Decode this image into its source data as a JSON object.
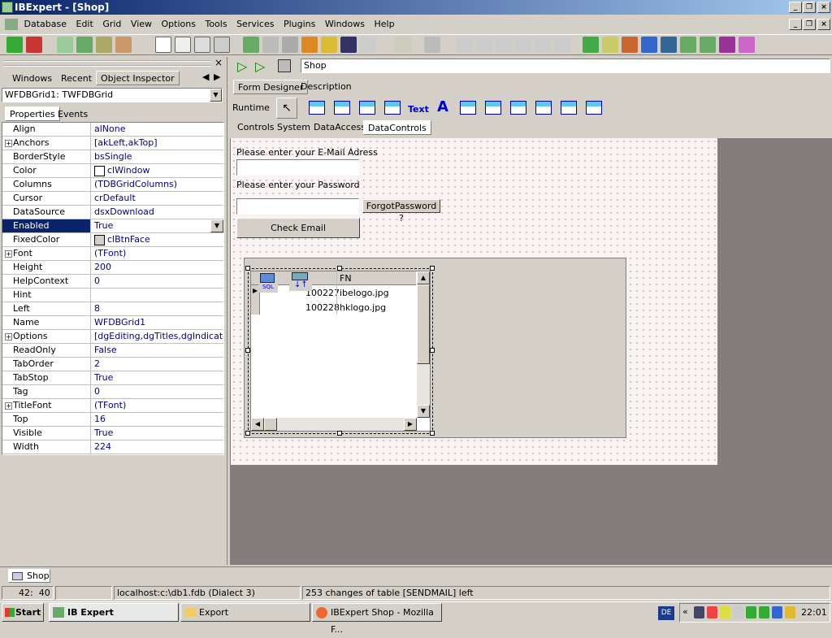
{
  "app": {
    "title": "IBExpert - [Shop]"
  },
  "menu": [
    "Database",
    "Edit",
    "Grid",
    "View",
    "Options",
    "Tools",
    "Services",
    "Plugins",
    "Windows",
    "Help"
  ],
  "left_panel": {
    "tabs": [
      "Windows",
      "Recent",
      "Object Inspector"
    ],
    "object_selector": "WFDBGrid1: TWFDBGrid",
    "subtabs": [
      "Properties",
      "Events"
    ],
    "properties": [
      {
        "k": "Align",
        "v": "alNone"
      },
      {
        "k": "Anchors",
        "v": "[akLeft,akTop]",
        "plus": true
      },
      {
        "k": "BorderStyle",
        "v": "bsSingle"
      },
      {
        "k": "Color",
        "v": "clWindow",
        "swatch": "#ffffff"
      },
      {
        "k": "Columns",
        "v": "(TDBGridColumns)"
      },
      {
        "k": "Cursor",
        "v": "crDefault"
      },
      {
        "k": "DataSource",
        "v": "dsxDownload"
      },
      {
        "k": "Enabled",
        "v": "True",
        "selected": true
      },
      {
        "k": "FixedColor",
        "v": "clBtnFace",
        "swatch": "#d4d0c8"
      },
      {
        "k": "Font",
        "v": "(TFont)",
        "plus": true
      },
      {
        "k": "Height",
        "v": "200"
      },
      {
        "k": "HelpContext",
        "v": "0"
      },
      {
        "k": "Hint",
        "v": ""
      },
      {
        "k": "Left",
        "v": "8"
      },
      {
        "k": "Name",
        "v": "WFDBGrid1"
      },
      {
        "k": "Options",
        "v": "[dgEditing,dgTitles,dgIndicator…",
        "plus": true
      },
      {
        "k": "ReadOnly",
        "v": "False"
      },
      {
        "k": "TabOrder",
        "v": "2"
      },
      {
        "k": "TabStop",
        "v": "True"
      },
      {
        "k": "Tag",
        "v": "0"
      },
      {
        "k": "TitleFont",
        "v": "(TFont)",
        "plus": true
      },
      {
        "k": "Top",
        "v": "16"
      },
      {
        "k": "Visible",
        "v": "True"
      },
      {
        "k": "Width",
        "v": "224"
      }
    ]
  },
  "editor": {
    "name_field": "Shop",
    "tabs": [
      "Form Designer",
      "Description"
    ],
    "runtime_label": "Runtime",
    "palette_text": "Text",
    "palette_tabs": [
      "Controls",
      "System",
      "DataAccess",
      "DataControls"
    ],
    "form": {
      "email_label": "Please enter your E-Mail Adress",
      "password_label": "Please enter your Password",
      "forgot_button": "ForgotPassword ?",
      "check_button": "Check Email",
      "grid_header": "FN",
      "grid_rows": [
        {
          "id": "100227",
          "fn": "ibelogo.jpg"
        },
        {
          "id": "100228",
          "fn": "hklogo.jpg"
        }
      ],
      "sql_label": "SQL"
    }
  },
  "bottom_tab": "Shop",
  "status": {
    "pos": "42:  40",
    "db": "localhost:c:\\db1.fdb (Dialect 3)",
    "changes": "253 changes of table [SENDMAIL] left"
  },
  "taskbar": {
    "start": "Start",
    "items": [
      "IB Expert",
      "Export",
      "IBExpert Shop - Mozilla F..."
    ],
    "lang": "DE",
    "time": "22:01"
  }
}
